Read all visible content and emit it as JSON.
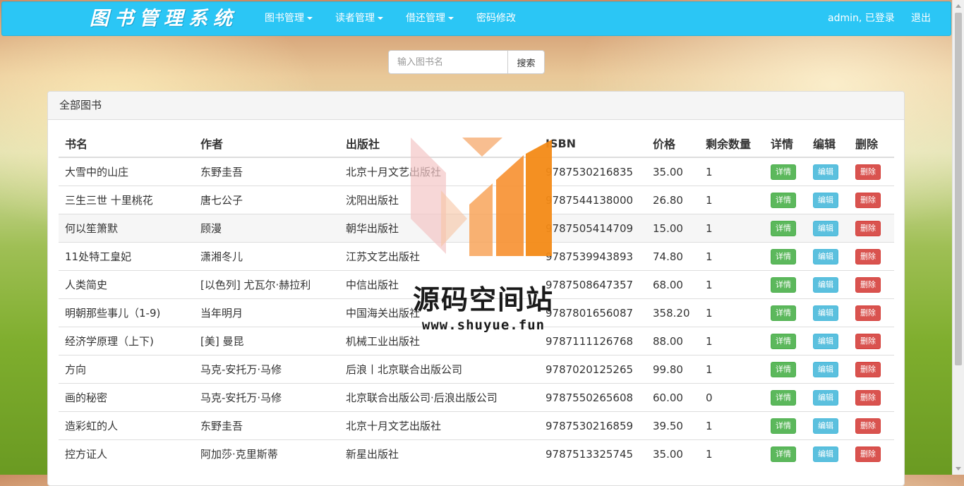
{
  "navbar": {
    "brand": "图书管理系统",
    "menus": [
      {
        "label": "图书管理",
        "dropdown": true
      },
      {
        "label": "读者管理",
        "dropdown": true
      },
      {
        "label": "借还管理",
        "dropdown": true
      },
      {
        "label": "密码修改",
        "dropdown": false
      }
    ],
    "user_status": "admin, 已登录",
    "logout": "退出",
    "color": "#2bc6f5"
  },
  "search": {
    "placeholder": "输入图书名",
    "value": "",
    "button": "搜索"
  },
  "panel": {
    "title": "全部图书"
  },
  "table": {
    "columns": [
      "书名",
      "作者",
      "出版社",
      "ISBN",
      "价格",
      "剩余数量",
      "详情",
      "编辑",
      "删除"
    ],
    "actions": {
      "detail": "详情",
      "edit": "编辑",
      "delete": "删除"
    },
    "rows": [
      {
        "title": "大雪中的山庄",
        "author": "东野圭吾",
        "publisher": "北京十月文艺出版社",
        "isbn": "9787530216835",
        "price": "35.00",
        "stock": "1"
      },
      {
        "title": "三生三世 十里桃花",
        "author": "唐七公子",
        "publisher": "沈阳出版社",
        "isbn": "9787544138000",
        "price": "26.80",
        "stock": "1"
      },
      {
        "title": "何以笙箫默",
        "author": "顾漫",
        "publisher": "朝华出版社",
        "isbn": "9787505414709",
        "price": "15.00",
        "stock": "1"
      },
      {
        "title": "11处特工皇妃",
        "author": "潇湘冬儿",
        "publisher": "江苏文艺出版社",
        "isbn": "9787539943893",
        "price": "74.80",
        "stock": "1"
      },
      {
        "title": "人类简史",
        "author": "[以色列] 尤瓦尔·赫拉利",
        "publisher": "中信出版社",
        "isbn": "9787508647357",
        "price": "68.00",
        "stock": "1"
      },
      {
        "title": "明朝那些事儿（1-9)",
        "author": "当年明月",
        "publisher": "中国海关出版社",
        "isbn": "9787801656087",
        "price": "358.20",
        "stock": "1"
      },
      {
        "title": "经济学原理（上下)",
        "author": "[美] 曼昆",
        "publisher": "机械工业出版社",
        "isbn": "9787111126768",
        "price": "88.00",
        "stock": "1"
      },
      {
        "title": "方向",
        "author": "马克-安托万·马修",
        "publisher": "后浪丨北京联合出版公司",
        "isbn": "9787020125265",
        "price": "99.80",
        "stock": "1"
      },
      {
        "title": "画的秘密",
        "author": "马克-安托万·马修",
        "publisher": "北京联合出版公司·后浪出版公司",
        "isbn": "9787550265608",
        "price": "60.00",
        "stock": "0"
      },
      {
        "title": "造彩虹的人",
        "author": "东野圭吾",
        "publisher": "北京十月文艺出版社",
        "isbn": "9787530216859",
        "price": "39.50",
        "stock": "1"
      },
      {
        "title": "控方证人",
        "author": "阿加莎·克里斯蒂",
        "publisher": "新星出版社",
        "isbn": "9787513325745",
        "price": "35.00",
        "stock": "1"
      }
    ]
  },
  "watermark": {
    "text": "源码空间站",
    "url": "www.shuyue.fun"
  }
}
